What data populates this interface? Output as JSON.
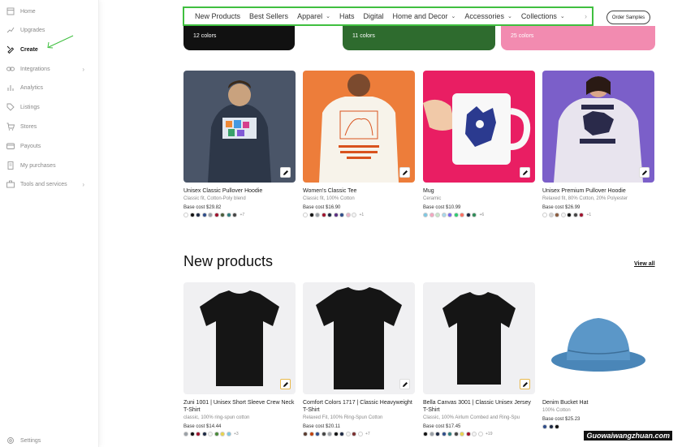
{
  "sidebar": {
    "items": [
      {
        "label": "Home",
        "icon": "home-icon"
      },
      {
        "label": "Upgrades",
        "icon": "trend-icon"
      },
      {
        "label": "Create",
        "icon": "create-icon"
      },
      {
        "label": "Integrations",
        "icon": "link-icon"
      },
      {
        "label": "Analytics",
        "icon": "bar-chart-icon"
      },
      {
        "label": "Listings",
        "icon": "tag-icon"
      },
      {
        "label": "Stores",
        "icon": "cart-icon"
      },
      {
        "label": "Payouts",
        "icon": "wallet-icon"
      },
      {
        "label": "My purchases",
        "icon": "document-icon"
      },
      {
        "label": "Tools and services",
        "icon": "toolbox-icon"
      }
    ],
    "settings_label": "Settings",
    "expand_glyph": "›"
  },
  "topnav": {
    "items": [
      {
        "label": "New Products",
        "dropdown": false
      },
      {
        "label": "Best Sellers",
        "dropdown": false
      },
      {
        "label": "Apparel",
        "dropdown": true
      },
      {
        "label": "Hats",
        "dropdown": false
      },
      {
        "label": "Digital",
        "dropdown": false
      },
      {
        "label": "Home and Decor",
        "dropdown": true
      },
      {
        "label": "Accessories",
        "dropdown": true
      },
      {
        "label": "Collections",
        "dropdown": true
      }
    ],
    "dropdown_glyph": "⌄",
    "more_glyph": "›",
    "highlight_color": "#3fbf3f"
  },
  "order_samples_label": "Order Samples",
  "banners": [
    {
      "label": "12 colors",
      "color": "#111111"
    },
    {
      "label": "11 colors",
      "color": "#2e6b2e"
    },
    {
      "label": "25 colors",
      "color": "#f28bb0"
    }
  ],
  "bestsellers": [
    {
      "title": "Unisex Classic Pullover Hoodie",
      "sub": "Classic fit, Cotton-Poly blend",
      "cost": "Base cost $29.82",
      "swatches": [
        "#ffffff",
        "#111111",
        "#1d2a44",
        "#2e4d8a",
        "#9aa0a6",
        "#a0122d",
        "#4a5d3a",
        "#2e7d7d",
        "#444444"
      ],
      "more": "+7"
    },
    {
      "title": "Women's Classic Tee",
      "sub": "Classic fit, 100% Cotton",
      "cost": "Base cost $16.90",
      "swatches": [
        "#ffffff",
        "#111111",
        "#9aa0a6",
        "#a0122d",
        "#1d2a44",
        "#5a2e82",
        "#2e4d8a",
        "#e8b4c8",
        "#f5f5f5"
      ],
      "more": "+1"
    },
    {
      "title": "Mug",
      "sub": "Ceramic",
      "cost": "Base cost $10.99",
      "swatches": [
        "#7ec8e3",
        "#f4a6c0",
        "#c8e6c9",
        "#a8d8ea",
        "#7b68ee",
        "#2ecc71",
        "#ff6f61",
        "#1d2a44",
        "#2e8b57"
      ],
      "more": "+6"
    },
    {
      "title": "Unisex Premium Pullover Hoodie",
      "sub": "Relaxed fit, 80% Cotton, 20% Polyester",
      "cost": "Base cost $26.99",
      "swatches": [
        "#ffffff",
        "#d8d8d8",
        "#8b5a3c",
        "#f5f5f5",
        "#111111",
        "#444444",
        "#a0122d"
      ],
      "more": "+1"
    }
  ],
  "new_products_title": "New products",
  "view_all_label": "View all",
  "new_products": [
    {
      "title": "Zuni 1001 | Unisex Short Sleeve Crew Neck T-Shirt",
      "sub": "classic, 100% ring-spun cotton",
      "cost": "Base cost $14.44",
      "swatches": [
        "#9aa0a6",
        "#111111",
        "#a0122d",
        "#1d2a44",
        "#f5f5f5",
        "#4a8a3a",
        "#e8d44d",
        "#7ec8e3"
      ],
      "more": "+3"
    },
    {
      "title": "Comfort Colors 1717 | Classic Heavyweight T-Shirt",
      "sub": "Relaxed Fit, 100% Ring-Spun Cotton",
      "cost": "Base cost $20.11",
      "swatches": [
        "#5a3a2e",
        "#c2410c",
        "#2e4d8a",
        "#444444",
        "#9aa0a6",
        "#111111",
        "#1d2a44",
        "#f5f5f5",
        "#7b2e2e",
        "#ffffff"
      ],
      "more": "+7"
    },
    {
      "title": "Bella Canvas 3001 | Classic Unisex Jersey T-Shirt",
      "sub": "Classic, 100% Airlum Combed and Ring-Spu",
      "cost": "Base cost $17.45",
      "swatches": [
        "#111111",
        "#9aa0a6",
        "#1d2a44",
        "#2e4d8a",
        "#2e7d7d",
        "#444444",
        "#e8d44d",
        "#a0122d",
        "#f5f5f5",
        "#ffffff"
      ],
      "more": "+19"
    },
    {
      "title": "Denim Bucket Hat",
      "sub": "100% Cotton",
      "cost": "Base cost $25.23",
      "swatches": [
        "#2e4d8a",
        "#1d2a44",
        "#111111"
      ],
      "more": ""
    }
  ],
  "watermark": "Guowaiwangzhuan.com"
}
